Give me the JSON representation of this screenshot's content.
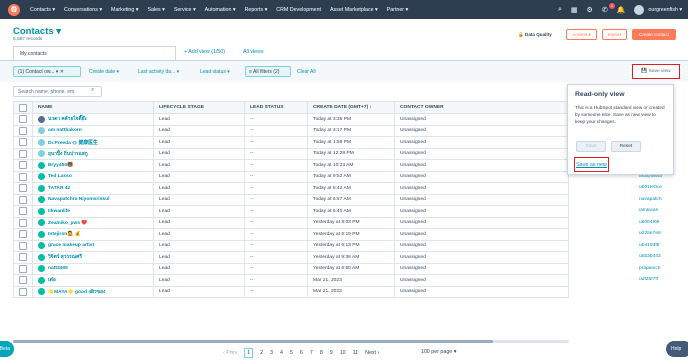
{
  "topnav": {
    "logo": "hubspot-logo",
    "menu": [
      "Contacts ▾",
      "Conversations ▾",
      "Marketing ▾",
      "Sales ▾",
      "Service ▾",
      "Automation ▾",
      "Reports ▾",
      "CRM Development",
      "Asset Marketplace ▾",
      "Partner ▾"
    ],
    "notifications": "1",
    "account": "ourgreenfish ▾"
  },
  "header": {
    "title": "Contacts ▾",
    "subtitle": "6,587 records",
    "data_quality": "Data Quality",
    "actions": "Actions ▾",
    "import": "Import",
    "create": "Create contact"
  },
  "views": {
    "current": "My contacts",
    "add_view": "+ Add view (1/50)",
    "all_views": "All views"
  },
  "filters": {
    "chip1": "(1) Contact ow... ▾   ✕",
    "create_date": "Create date ▾",
    "last_activity": "Last activity da... ▾",
    "lead_status": "Lead status ▾",
    "all_filters": "≡ All filters (2)",
    "clear_all": "Clear All",
    "save_view": "💾 Save view"
  },
  "search": {
    "placeholder": "Search name, phone, em"
  },
  "table": {
    "headers": [
      "NAME",
      "LIFECYCLE STAGE",
      "LEAD STATUS",
      "CREATE DATE (GMT+7) ↓",
      "CONTACT OWNER"
    ],
    "rows": [
      {
        "name": "นวดา คล้ายใจดี๊ย๊ะ",
        "stage": "Lead",
        "status": "--",
        "date": "Today at 3:35 PM",
        "owner": "Unassigned",
        "email": ""
      },
      {
        "name": "am natthakorn",
        "stage": "Lead",
        "status": "--",
        "date": "Today at 3:17 PM",
        "owner": "Unassigned",
        "email": ""
      },
      {
        "name": "Dr.Preeda @ 健康医生",
        "stage": "Lead",
        "status": "--",
        "date": "Today at 1:58 PM",
        "owner": "Unassigned",
        "email": ""
      },
      {
        "name": "ยุนาปิ้ง ถิ่นปารแสกู",
        "stage": "Lead",
        "status": "--",
        "date": "Today at 12:28 PM",
        "owner": "Unassigned",
        "email": ""
      },
      {
        "name": "Bryy455🐻",
        "stage": "Lead",
        "status": "--",
        "date": "Today at 10:23 AM",
        "owner": "Unassigned",
        "email": "u53ff6a8"
      },
      {
        "name": "Ted Lasso",
        "stage": "Lead",
        "status": "--",
        "date": "Today at 9:52 AM",
        "owner": "Unassigned",
        "email": "ted@lasso"
      },
      {
        "name": "TATAR 42",
        "stage": "Lead",
        "status": "--",
        "date": "Today at 8:42 AM",
        "owner": "Unassigned",
        "email": "ub01fe0ce"
      },
      {
        "name": "Navapatchra Niyomsriskul",
        "stage": "Lead",
        "status": "--",
        "date": "Today at 6:57 AM",
        "owner": "Unassigned",
        "email": "navapatch"
      },
      {
        "name": "Iikwanlife",
        "stage": "Lead",
        "status": "--",
        "date": "Today at 6:40 AM",
        "owner": "Unassigned",
        "email": "iamkwan"
      },
      {
        "name": "Zeamiko_pws ❤️",
        "stage": "Lead",
        "status": "--",
        "date": "Yesterday at 8:03 PM",
        "owner": "Unassigned",
        "email": "u6004f96"
      },
      {
        "name": "Intejiron🤷 💰",
        "stage": "Lead",
        "status": "--",
        "date": "Yesterday at 6:19 PM",
        "owner": "Unassigned",
        "email": "u228e7e9"
      },
      {
        "name": "grace makeup artist",
        "stage": "Lead",
        "status": "--",
        "date": "Yesterday at 6:13 PM",
        "owner": "Unassigned",
        "email": "ub4193f8"
      },
      {
        "name": "วิจิตร์ สุวรรณศรี",
        "stage": "Lead",
        "status": "--",
        "date": "Yesterday at 9:36 AM",
        "owner": "Unassigned",
        "email": "ubb3b443"
      },
      {
        "name": "natt3495",
        "stage": "Lead",
        "status": "--",
        "date": "Yesterday at 6:50 AM",
        "owner": "Unassigned",
        "email": "prapanich"
      },
      {
        "name": "เต๋อ",
        "stage": "Lead",
        "status": "--",
        "date": "Mar 21, 2023",
        "owner": "Unassigned",
        "email": "udf25f7ff"
      },
      {
        "name": "🌟MAYA🌟 good 4ผิวของ",
        "stage": "Lead",
        "status": "--",
        "date": "Mar 21, 2023",
        "owner": "Unassigned",
        "email": ""
      }
    ]
  },
  "popup": {
    "title": "Read-only view",
    "body": "This is a HubSpot standard view or created by someone else. Save as new view to keep your changes.",
    "save": "Save",
    "reset": "Reset",
    "save_as_new": "Save as new"
  },
  "pager": {
    "prev": "‹  Prev",
    "pages": [
      "1",
      "2",
      "3",
      "4",
      "5",
      "6",
      "7",
      "8",
      "9",
      "10",
      "11"
    ],
    "next": "Next  ›",
    "per_page": "100 per page ▾"
  },
  "widgets": {
    "beta": "Beta",
    "help": "Help"
  }
}
